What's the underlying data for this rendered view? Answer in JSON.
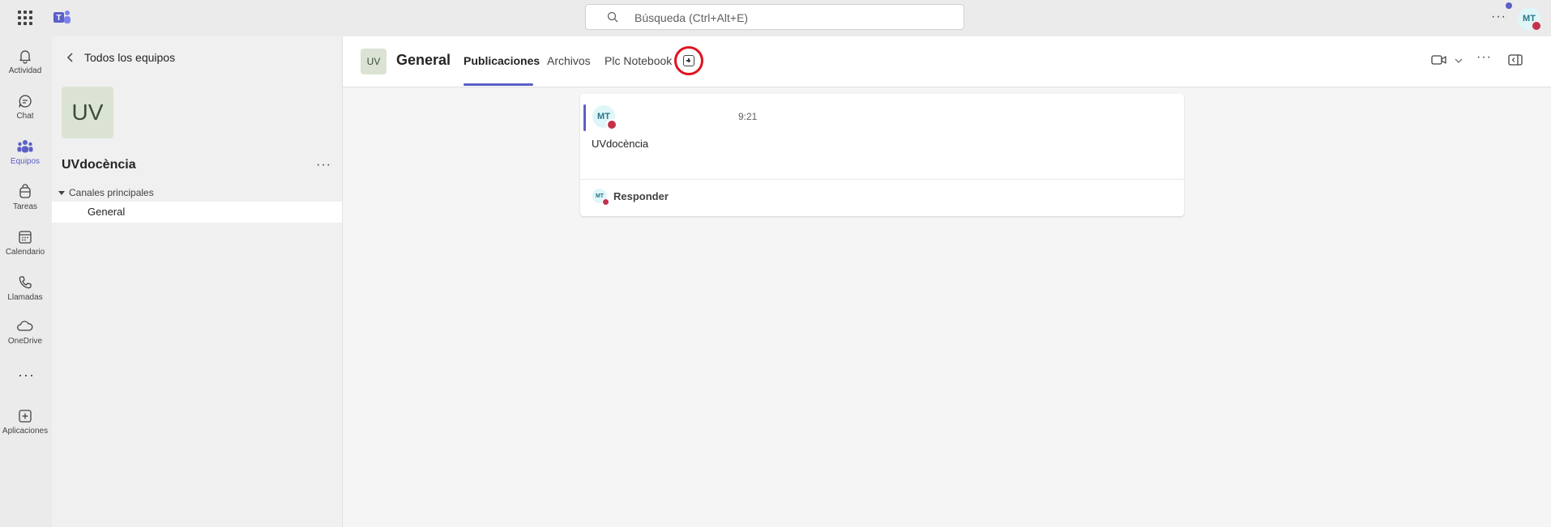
{
  "search": {
    "placeholder": "Búsqueda (Ctrl+Alt+E)"
  },
  "user": {
    "initials": "MT"
  },
  "rail": {
    "items": [
      {
        "label": "Actividad",
        "icon": "bell-icon"
      },
      {
        "label": "Chat",
        "icon": "chat-icon"
      },
      {
        "label": "Equipos",
        "icon": "teams-icon",
        "active": true
      },
      {
        "label": "Tareas",
        "icon": "tasks-icon"
      },
      {
        "label": "Calendario",
        "icon": "calendar-icon"
      },
      {
        "label": "Llamadas",
        "icon": "phone-icon"
      },
      {
        "label": "OneDrive",
        "icon": "cloud-icon"
      },
      {
        "label": "Aplicaciones",
        "icon": "add-apps-icon"
      }
    ],
    "more": "···"
  },
  "team_panel": {
    "back_label": "Todos los equipos",
    "team_initials": "UV",
    "team_name": "UVdocència",
    "more": "···",
    "section_label": "Canales principales",
    "channels": [
      {
        "label": "General"
      }
    ]
  },
  "channel_header": {
    "initials": "UV",
    "name": "General",
    "tabs": [
      {
        "label": "Publicaciones",
        "active": true
      },
      {
        "label": "Archivos"
      },
      {
        "label": "Plc Notebook"
      }
    ],
    "more": "···"
  },
  "post": {
    "author_initials": "MT",
    "time": "9:21",
    "text": "UVdocència",
    "reply_label": "Responder"
  },
  "colors": {
    "accent": "#5b5fc7",
    "highlight": "#e0131f",
    "presence_busy": "#c4314b"
  }
}
